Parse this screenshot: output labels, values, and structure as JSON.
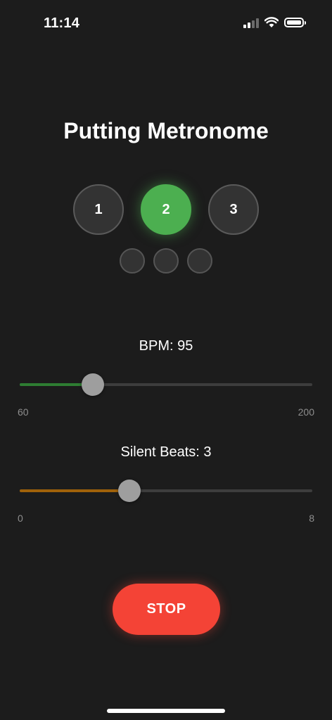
{
  "status_bar": {
    "time": "11:14",
    "signal_icon": "cellular-signal-icon",
    "wifi_icon": "wifi-icon",
    "battery_icon": "battery-icon"
  },
  "title": "Putting Metronome",
  "beats": [
    {
      "label": "1",
      "active": false
    },
    {
      "label": "2",
      "active": true
    },
    {
      "label": "3",
      "active": false
    }
  ],
  "silent_beat_indicators": [
    {
      "active": false
    },
    {
      "active": false
    },
    {
      "active": false
    }
  ],
  "bpm": {
    "label": "BPM: 95",
    "value": 95,
    "min": 60,
    "max": 200,
    "min_label": "60",
    "max_label": "200",
    "fill_color": "#2e7d32"
  },
  "silent_beats": {
    "label": "Silent Beats: 3",
    "value": 3,
    "min": 0,
    "max": 8,
    "min_label": "0",
    "max_label": "8",
    "fill_color": "#a0620a"
  },
  "stop_button": {
    "label": "STOP",
    "color": "#f44336"
  },
  "colors": {
    "background": "#1c1c1c",
    "active_beat": "#4caf50"
  }
}
